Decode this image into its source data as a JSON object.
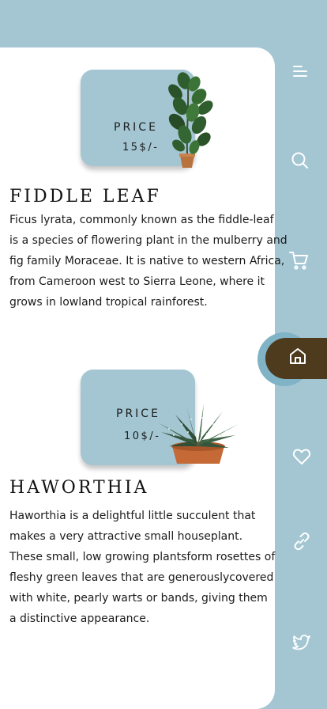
{
  "nav": {
    "items": [
      {
        "icon": "menu-icon"
      },
      {
        "icon": "search-icon"
      },
      {
        "icon": "cart-icon"
      },
      {
        "icon": "home-icon",
        "active": true
      },
      {
        "icon": "heart-icon"
      },
      {
        "icon": "link-icon"
      },
      {
        "icon": "twitter-icon"
      }
    ],
    "active_color": "#4e3a1c"
  },
  "products": [
    {
      "price_label": "PRICE",
      "price": "15$/-",
      "title": "FIDDLE LEAF",
      "description": "Ficus lyrata, commonly known as the fiddle-leaf\n is a species of flowering plant in the mulberry and\nfig family Moraceae. It is native to western Africa,\nfrom Cameroon west to Sierra Leone, where it\ngrows in lowland tropical rainforest.",
      "image": "fiddle-leaf-plant"
    },
    {
      "price_label": "PRICE",
      "price": "10$/-",
      "title": "HAWORTHIA",
      "description": "Haworthia is a delightful little succulent that\nmakes a very attractive small houseplant.\nThese small, low growing plantsform rosettes of\nfleshy green leaves that are generouslycovered\nwith white, pearly warts or bands, giving them\na distinctive appearance.",
      "image": "haworthia-plant"
    }
  ],
  "colors": {
    "background": "#a3c6d2",
    "card": "#ffffff",
    "accent": "#4e3a1c"
  }
}
